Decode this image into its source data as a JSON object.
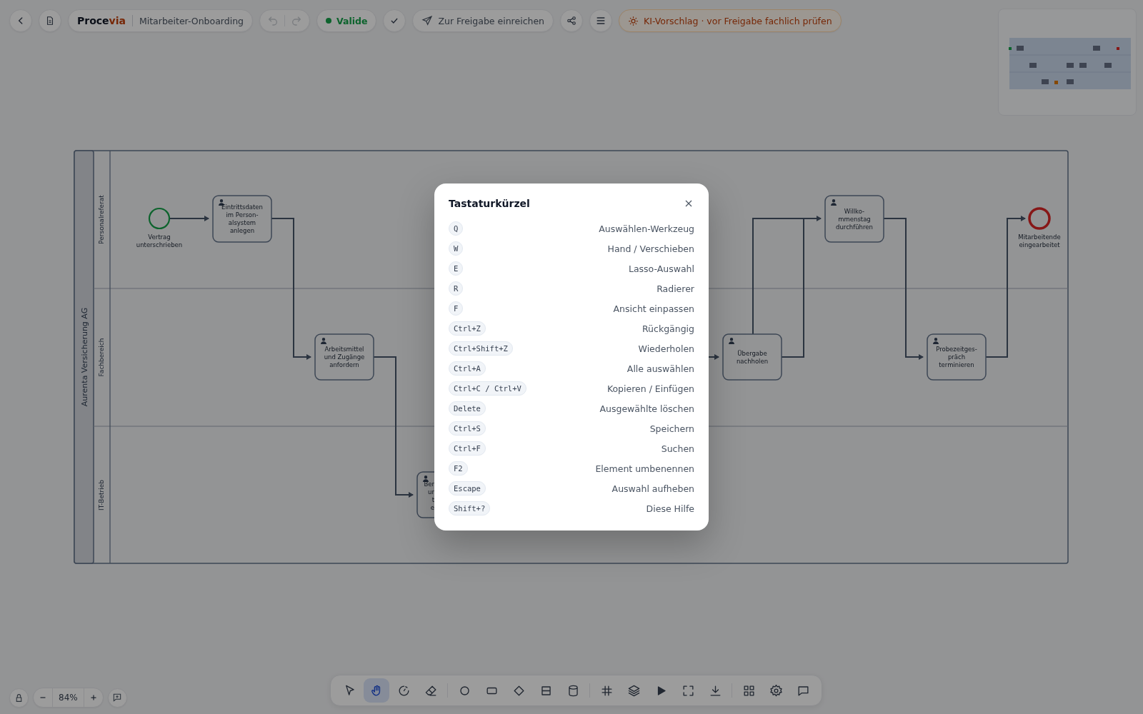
{
  "toolbar": {
    "brand_main": "Proce",
    "brand_accent": "via",
    "document_title": "Mitarbeiter-Onboarding",
    "undo_disabled": true,
    "redo_disabled": true,
    "status": {
      "label": "Valide",
      "valid": true
    },
    "submit_label": "Zur Freigabe einreichen",
    "ai_notice": "KI-Vorschlag · vor Freigabe fachlich prüfen"
  },
  "diagram": {
    "pool": "Aurenta Versicherung AG",
    "lanes": [
      "Personalreferat",
      "Fachbereich",
      "IT-Betrieb"
    ],
    "nodes": [
      {
        "kind": "start",
        "lines": [
          "Vertrag",
          "unterschrieben"
        ]
      },
      {
        "kind": "task",
        "lines": [
          "Eintrittsdaten",
          "im Person-",
          "alsystem",
          "anlegen"
        ]
      },
      {
        "kind": "task",
        "lines": [
          "Arbeitsmittel",
          "und Zugänge",
          "anfordern"
        ]
      },
      {
        "kind": "task_cut",
        "lines": [
          "Ber",
          "ur",
          "t",
          "e"
        ]
      },
      {
        "kind": "task",
        "lines": [
          "Übergabe",
          "nachholen"
        ]
      },
      {
        "kind": "task",
        "lines": [
          "Willko-",
          "mmenstag",
          "durchführen"
        ]
      },
      {
        "kind": "task",
        "lines": [
          "Probezeitges-",
          "präch",
          "terminieren"
        ]
      },
      {
        "kind": "end",
        "lines": [
          "Mitarbeitende",
          "eingearbeitet"
        ]
      }
    ]
  },
  "zoom": {
    "value": "84%"
  },
  "tool_groups": [
    [
      {
        "kind": "pointer",
        "selected": false
      },
      {
        "kind": "hand",
        "selected": true
      },
      {
        "kind": "lasso",
        "selected": false
      },
      {
        "kind": "eraser",
        "selected": false
      }
    ],
    [
      {
        "kind": "circle",
        "selected": false
      },
      {
        "kind": "rect",
        "selected": false
      },
      {
        "kind": "diamond",
        "selected": false
      },
      {
        "kind": "lane",
        "selected": false
      },
      {
        "kind": "database",
        "selected": false
      }
    ],
    [
      {
        "kind": "grid",
        "selected": false
      },
      {
        "kind": "layers",
        "selected": false
      },
      {
        "kind": "play",
        "selected": false
      },
      {
        "kind": "fullscreen",
        "selected": false
      },
      {
        "kind": "download",
        "selected": false
      }
    ],
    [
      {
        "kind": "apps",
        "selected": false
      },
      {
        "kind": "settings",
        "selected": false
      },
      {
        "kind": "comment",
        "selected": false
      }
    ]
  ],
  "shortcuts": {
    "title": "Tastaturkürzel",
    "items": [
      {
        "keys": "Q",
        "action": "Auswählen-Werkzeug"
      },
      {
        "keys": "W",
        "action": "Hand / Verschieben"
      },
      {
        "keys": "E",
        "action": "Lasso-Auswahl"
      },
      {
        "keys": "R",
        "action": "Radierer"
      },
      {
        "keys": "F",
        "action": "Ansicht einpassen"
      },
      {
        "keys": "Ctrl+Z",
        "action": "Rückgängig"
      },
      {
        "keys": "Ctrl+Shift+Z",
        "action": "Wiederholen"
      },
      {
        "keys": "Ctrl+A",
        "action": "Alle auswählen"
      },
      {
        "keys": "Ctrl+C / Ctrl+V",
        "action": "Kopieren / Einfügen"
      },
      {
        "keys": "Delete",
        "action": "Ausgewählte löschen"
      },
      {
        "keys": "Ctrl+S",
        "action": "Speichern"
      },
      {
        "keys": "Ctrl+F",
        "action": "Suchen"
      },
      {
        "keys": "F2",
        "action": "Element umbenennen"
      },
      {
        "keys": "Escape",
        "action": "Auswahl aufheben"
      },
      {
        "keys": "Shift+?",
        "action": "Diese Hilfe"
      }
    ]
  }
}
